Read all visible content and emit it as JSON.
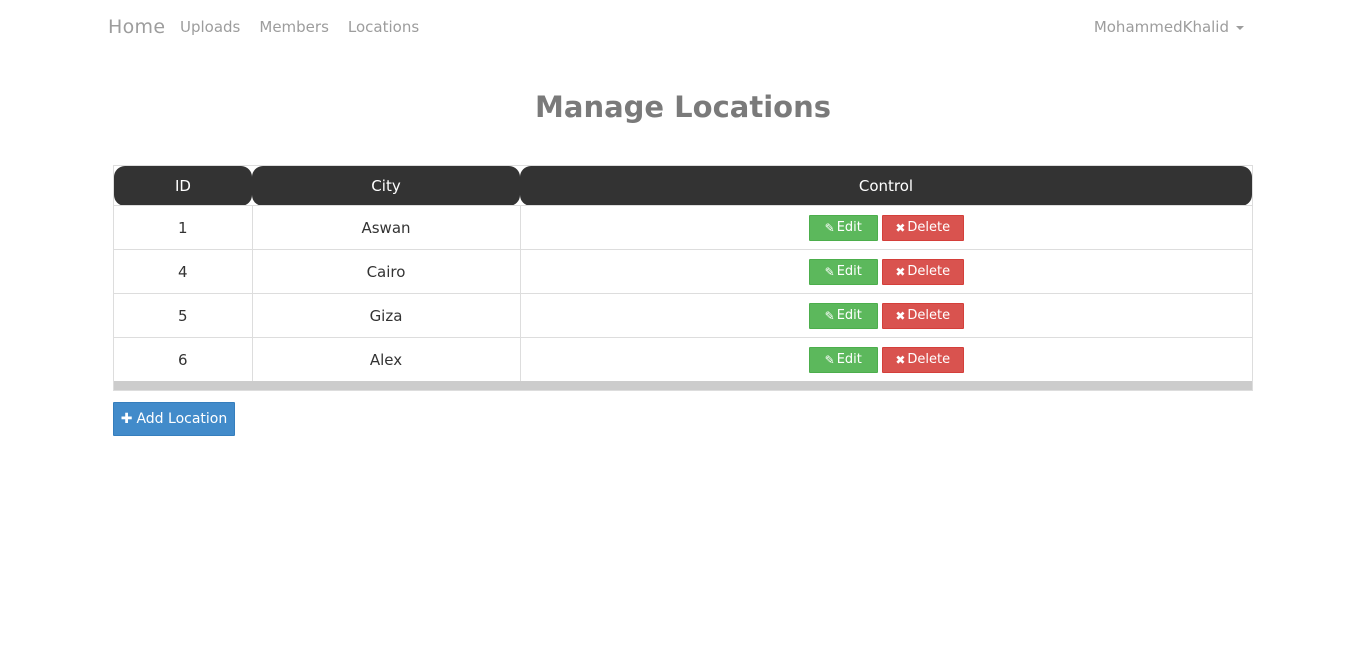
{
  "nav": {
    "brand": "Home",
    "links": [
      "Uploads",
      "Members",
      "Locations"
    ],
    "user": "MohammedKhalid"
  },
  "page": {
    "title": "Manage Locations"
  },
  "table": {
    "headers": [
      "ID",
      "City",
      "Control"
    ],
    "rows": [
      {
        "id": "1",
        "city": "Aswan"
      },
      {
        "id": "4",
        "city": "Cairo"
      },
      {
        "id": "5",
        "city": "Giza"
      },
      {
        "id": "6",
        "city": "Alex"
      }
    ],
    "edit_label": "Edit",
    "delete_label": "Delete"
  },
  "actions": {
    "add_label": "Add Location"
  },
  "icons": {
    "edit": "edit-icon",
    "delete": "times-icon",
    "add": "plus-icon"
  },
  "colors": {
    "success": "#5cb85c",
    "danger": "#d9534f",
    "primary": "#428bca",
    "header": "#333333"
  }
}
